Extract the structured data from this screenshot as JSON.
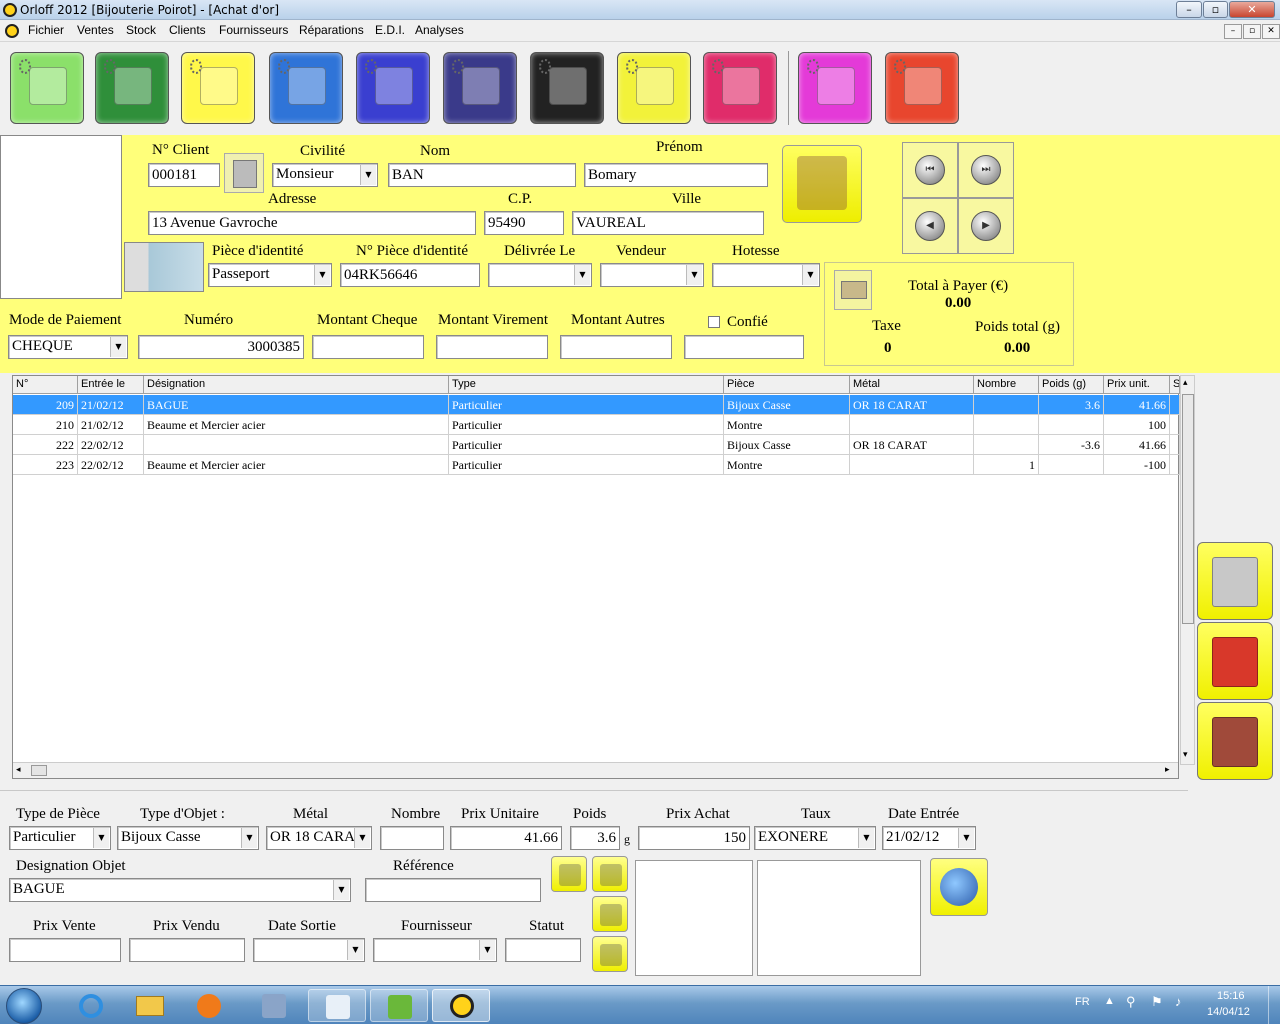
{
  "window": {
    "title": "Orloff 2012 [Bijouterie Poirot] - [Achat d'or]"
  },
  "menu": [
    "Fichier",
    "Ventes",
    "Stock",
    "Clients",
    "Fournisseurs",
    "Réparations",
    "E.D.I.",
    "Analyses"
  ],
  "toolbar": [
    {
      "name": "cash-register-icon",
      "color": "#8be06a"
    },
    {
      "name": "pyramid-icon",
      "color": "#2f8f3a"
    },
    {
      "name": "gold-purchase-icon",
      "color": "#fff84a"
    },
    {
      "name": "diamond-icon",
      "color": "#2f74d8"
    },
    {
      "name": "clipboard-icon",
      "color": "#3a3fd0"
    },
    {
      "name": "safe-icon",
      "color": "#3a3a8a"
    },
    {
      "name": "toolbox-icon",
      "color": "#222222"
    },
    {
      "name": "clients-icon",
      "color": "#f2f23a"
    },
    {
      "name": "people-icon",
      "color": "#e02c6a"
    },
    {
      "name": "analysis-icon",
      "color": "#e43ad8"
    },
    {
      "name": "exit-door-icon",
      "color": "#e8462e"
    }
  ],
  "client": {
    "num_label": "N° Client",
    "num": "000181",
    "civilite_label": "Civilité",
    "civilite": "Monsieur",
    "nom_label": "Nom",
    "nom": "BAN",
    "prenom_label": "Prénom",
    "prenom": "Bomary",
    "adresse_label": "Adresse",
    "adresse": "13 Avenue Gavroche",
    "cp_label": "C.P.",
    "cp": "95490",
    "ville_label": "Ville",
    "ville": "VAUREAL",
    "piece_label": "Pièce d'identité",
    "piece": "Passeport",
    "npiece_label": "N° Pièce d'identité",
    "npiece": "04RK56646",
    "delivree_label": "Délivrée Le",
    "delivree": "",
    "vendeur_label": "Vendeur",
    "vendeur": "",
    "hotesse_label": "Hotesse",
    "hotesse": ""
  },
  "totals": {
    "total_label": "Total à Payer (€)",
    "total": "0.00",
    "taxe_label": "Taxe",
    "taxe": "0",
    "poids_label": "Poids total (g)",
    "poids": "0.00"
  },
  "payment": {
    "mode_label": "Mode de Paiement",
    "mode": "CHEQUE",
    "numero_label": "Numéro",
    "numero": "3000385",
    "cheque_label": "Montant Cheque",
    "cheque": "",
    "virement_label": "Montant Virement",
    "virement": "",
    "autres_label": "Montant Autres",
    "autres": "",
    "confie_label": "Confié",
    "confie": ""
  },
  "grid": {
    "columns": [
      "N°",
      "Entrée le",
      "Désignation",
      "Type",
      "Pièce",
      "Métal",
      "Nombre",
      "Poids (g)",
      "Prix unit.",
      "S"
    ],
    "rows": [
      [
        "209",
        "21/02/12",
        "BAGUE",
        "Particulier",
        "Bijoux Casse",
        "OR 18 CARAT",
        "",
        "3.6",
        "41.66",
        ""
      ],
      [
        "210",
        "21/02/12",
        "Beaume et Mercier acier",
        "Particulier",
        "Montre",
        "",
        "",
        "",
        "100",
        ""
      ],
      [
        "222",
        "22/02/12",
        "",
        "Particulier",
        "Bijoux Casse",
        "OR 18 CARAT",
        "",
        "-3.6",
        "41.66",
        ""
      ],
      [
        "223",
        "22/02/12",
        "Beaume et Mercier acier",
        "Particulier",
        "Montre",
        "",
        "1",
        "",
        "-100",
        ""
      ]
    ]
  },
  "item": {
    "type_piece_label": "Type de Pièce",
    "type_piece": "Particulier",
    "type_objet_label": "Type d'Objet :",
    "type_objet": "Bijoux Casse",
    "metal_label": "Métal",
    "metal": "OR 18 CARA",
    "nombre_label": "Nombre",
    "nombre": "",
    "prix_unit_label": "Prix Unitaire",
    "prix_unit": "41.66",
    "poids_label": "Poids",
    "poids": "3.6",
    "poids_unit": "g",
    "prix_achat_label": "Prix Achat",
    "prix_achat": "150",
    "taux_label": "Taux",
    "taux": "EXONERE",
    "date_entree_label": "Date Entrée",
    "date_entree": "21/02/12",
    "designation_label": "Designation Objet",
    "designation": "BAGUE",
    "reference_label": "Référence",
    "reference": "",
    "prix_vente_label": "Prix Vente",
    "prix_vente": "",
    "prix_vendu_label": "Prix Vendu",
    "prix_vendu": "",
    "date_sortie_label": "Date Sortie",
    "date_sortie": "",
    "fournisseur_label": "Fournisseur",
    "fournisseur": "",
    "statut_label": "Statut",
    "statut": ""
  },
  "taskbar": {
    "lang": "FR",
    "time": "15:16",
    "date": "14/04/12"
  }
}
